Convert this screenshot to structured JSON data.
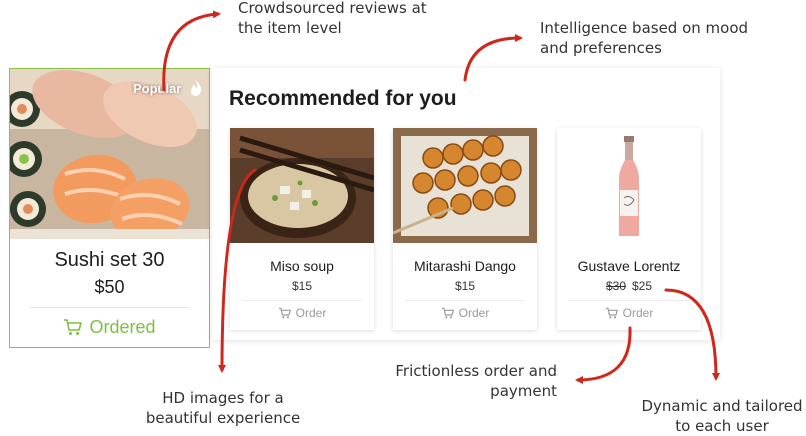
{
  "annotations": {
    "reviews_line1": "Crowdsourced reviews at",
    "reviews_line2": "the item level",
    "intelligence_line1": "Intelligence based on mood",
    "intelligence_line2": "and preferences",
    "hd_line1": "HD images for a",
    "hd_line2": "beautiful experience",
    "frictionless_line1": "Frictionless order and",
    "frictionless_line2": "payment",
    "dynamic_line1": "Dynamic and tailored",
    "dynamic_line2": "to each user"
  },
  "featured": {
    "badge": "Popular",
    "badge_icon": "flame-icon",
    "title": "Sushi set 30",
    "price": "$50",
    "status": "Ordered",
    "status_icon": "cart-icon",
    "status_color": "#7cc142"
  },
  "recommended": {
    "heading": "Recommended for you",
    "items": [
      {
        "name": "Miso soup",
        "price": "$15",
        "old_price": "",
        "action": "Order"
      },
      {
        "name": "Mitarashi Dango",
        "price": "$15",
        "old_price": "",
        "action": "Order"
      },
      {
        "name": "Gustave Lorentz",
        "price": "$25",
        "old_price": "$30",
        "action": "Order"
      }
    ]
  },
  "colors": {
    "arrow": "#d0271d",
    "accent_green": "#7cc142",
    "border_green": "#8bc34a"
  }
}
